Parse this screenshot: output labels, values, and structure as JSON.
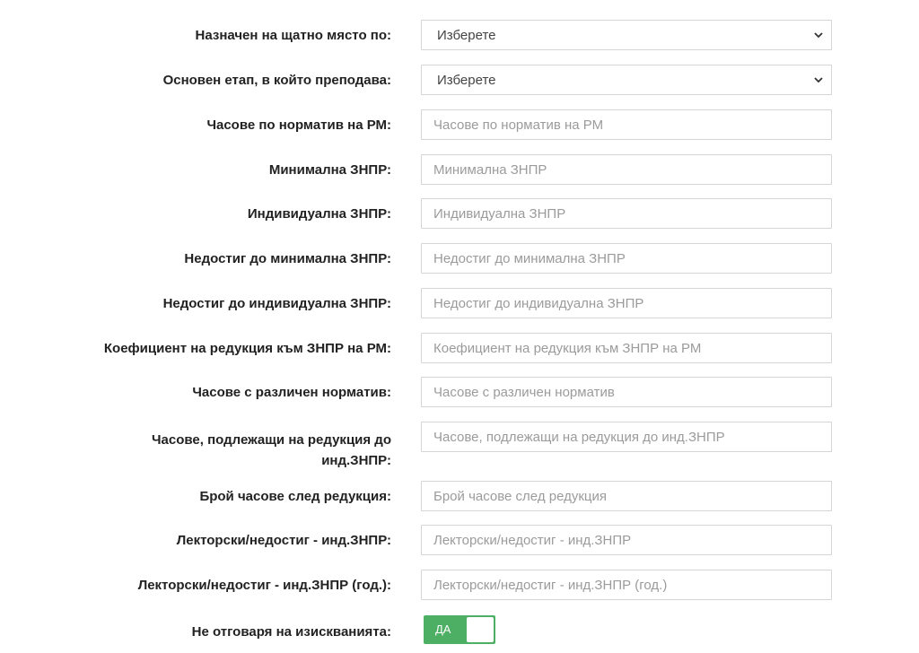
{
  "rows": [
    {
      "label": "Назначен на щатно място по:",
      "type": "select",
      "value": "Изберете"
    },
    {
      "label": "Основен етап, в който преподава:",
      "type": "select",
      "value": "Изберете"
    },
    {
      "label": "Часове по норматив на РМ:",
      "type": "input",
      "placeholder": "Часове по норматив на РМ"
    },
    {
      "label": "Минимална ЗНПР:",
      "type": "input",
      "placeholder": "Минимална ЗНПР"
    },
    {
      "label": "Индивидуална ЗНПР:",
      "type": "input",
      "placeholder": "Индивидуална ЗНПР"
    },
    {
      "label": "Недостиг до минимална ЗНПР:",
      "type": "input",
      "placeholder": "Недостиг до минимална ЗНПР"
    },
    {
      "label": "Недостиг до индивидуална ЗНПР:",
      "type": "input",
      "placeholder": "Недостиг до индивидуална ЗНПР"
    },
    {
      "label": "Коефициент на редукция към ЗНПР на РМ:",
      "type": "input",
      "placeholder": "Коефициент на редукция към ЗНПР на РМ"
    },
    {
      "label": "Часове с различен норматив:",
      "type": "input",
      "placeholder": "Часове с различен норматив"
    },
    {
      "label": "Часове, подлежащи на редукция до инд.ЗНПР:",
      "type": "input",
      "placeholder": "Часове, подлежащи на редукция до инд.ЗНПР"
    },
    {
      "label": "Брой часове след редукция:",
      "type": "input",
      "placeholder": "Брой часове след редукция"
    },
    {
      "label": "Лекторски/недостиг - инд.ЗНПР:",
      "type": "input",
      "placeholder": "Лекторски/недостиг - инд.ЗНПР"
    },
    {
      "label": "Лекторски/недостиг - инд.ЗНПР (год.):",
      "type": "input",
      "placeholder": "Лекторски/недостиг - инд.ЗНПР (год.)"
    },
    {
      "label": "Не отговаря на изискванията:",
      "type": "toggle",
      "value": "ДА",
      "checked": true,
      "color": "#4caf63"
    }
  ]
}
